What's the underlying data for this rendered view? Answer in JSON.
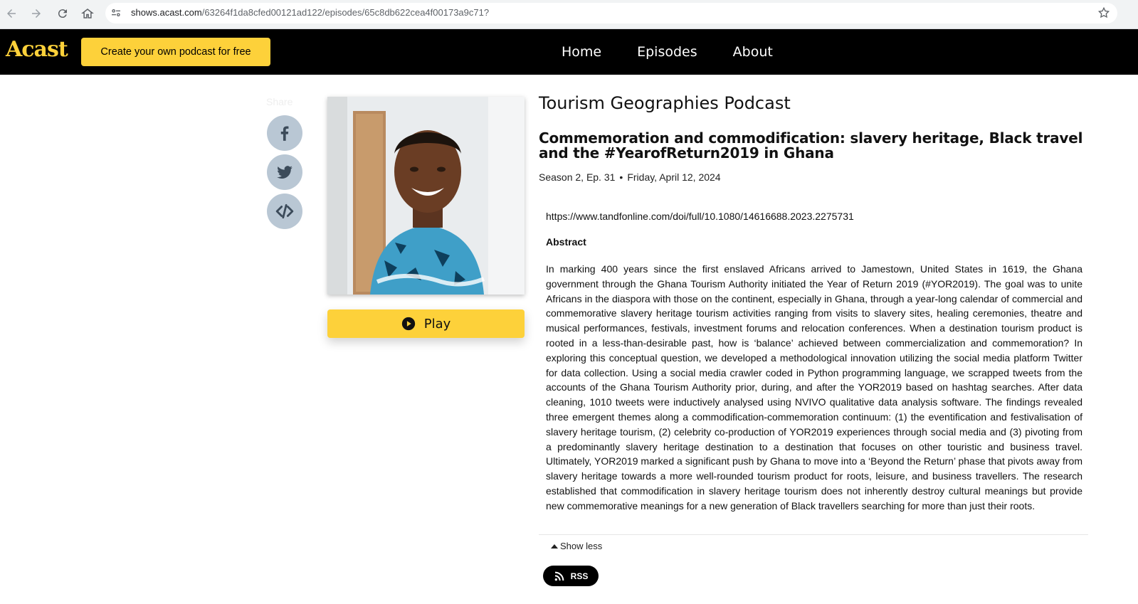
{
  "browser": {
    "url_host": "shows.acast.com",
    "url_path": "/63264f1da8cfed00121ad122/episodes/65c8db622cea4f00173a9c71?"
  },
  "header": {
    "logo_text": "Acast",
    "cta_label": "Create your own podcast for free",
    "nav": [
      {
        "label": "Home"
      },
      {
        "label": "Episodes"
      },
      {
        "label": "About"
      }
    ]
  },
  "share": {
    "label": "Share",
    "buttons": [
      {
        "icon": "facebook-icon"
      },
      {
        "icon": "twitter-icon"
      },
      {
        "icon": "embed-code-icon"
      }
    ]
  },
  "player": {
    "play_label": "Play"
  },
  "episode": {
    "show_title": "Tourism Geographies Podcast",
    "title": "Commemoration and commodification: slavery heritage, Black travel and the #YearofReturn2019 in Ghana",
    "season_episode": "Season 2, Ep. 31",
    "separator": "•",
    "date": "Friday, April 12, 2024",
    "doi_link": "https://www.tandfonline.com/doi/full/10.1080/14616688.2023.2275731",
    "abstract_heading": "Abstract",
    "abstract": "In marking 400 years since the first enslaved Africans arrived to Jamestown, United States in 1619, the Ghana government through the Ghana Tourism Authority initiated the Year of Return 2019 (#YOR2019). The goal was to unite Africans in the diaspora with those on the continent, especially in Ghana, through a year-long calendar of commercial and commemorative slavery heritage tourism activities ranging from visits to slavery sites, healing ceremonies, theatre and musical performances, festivals, investment forums and relocation conferences. When a destination tourism product is rooted in a less-than-desirable past, how is ‘balance’ achieved between commercialization and commemoration? In exploring this conceptual question, we developed a methodological innovation utilizing the social media platform Twitter for data collection. Using a social media crawler coded in Python programming language, we scrapped tweets from the accounts of the Ghana Tourism Authority prior, during, and after the YOR2019 based on hashtag searches. After data cleaning, 1010 tweets were inductively analysed using NVIVO qualitative data analysis software. The findings revealed three emergent themes along a commodification-commemoration continuum: (1) the eventification and festivalisation of slavery heritage tourism, (2) celebrity co-production of YOR2019 experiences through social media and (3) pivoting from a predominantly slavery heritage destination to a destination that focuses on other touristic and business travel. Ultimately, YOR2019 marked a significant push by Ghana to move into a ‘Beyond the Return’ phase that pivots away from slavery heritage towards a more well-rounded tourism product for roots, leisure, and business travellers. The research established that commodification in slavery heritage tourism does not inherently destroy cultural meanings but provide new commemorative meanings for a new generation of Black travellers searching for more than just their roots.",
    "show_less_label": "Show less",
    "rss_label": "RSS"
  },
  "colors": {
    "brand_yellow": "#fdd13a",
    "header_bg": "#000000",
    "share_button_bg": "#b9c7d4"
  }
}
